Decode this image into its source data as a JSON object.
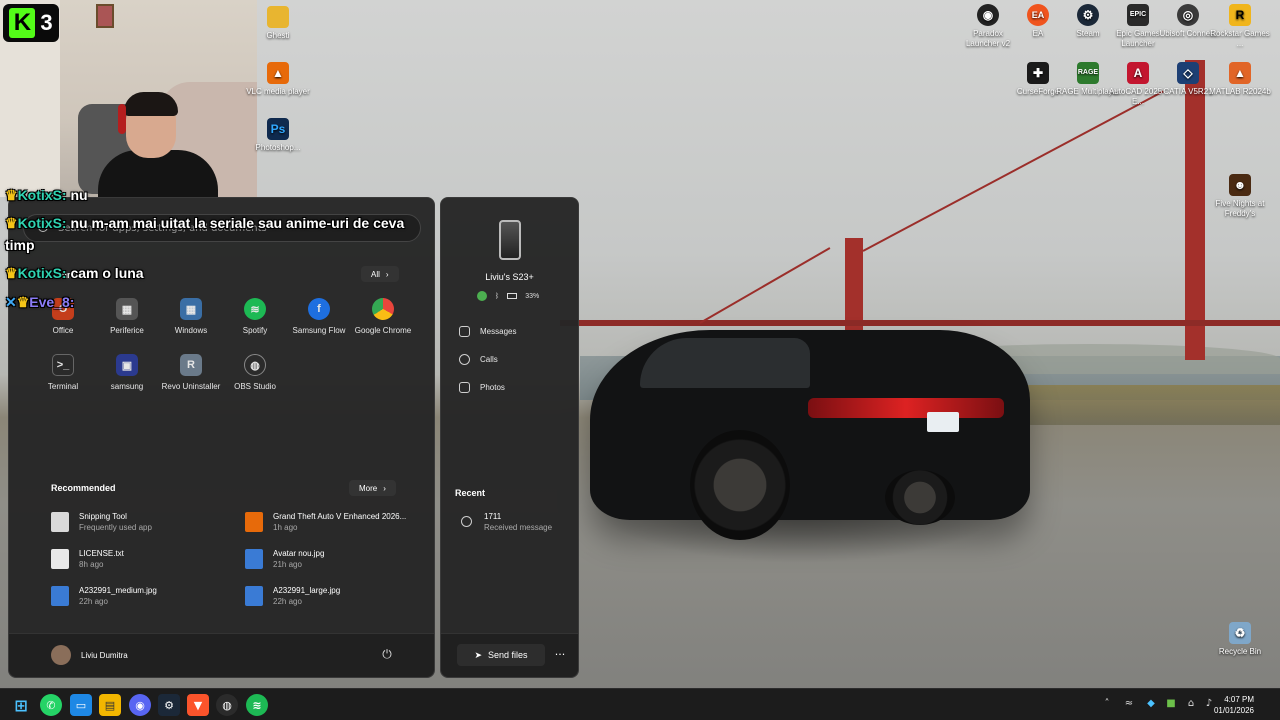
{
  "overlay": {
    "logo_letter": "K",
    "logo_count": "3"
  },
  "chat": [
    {
      "user": "KotixS:",
      "text": "nu"
    },
    {
      "user": "KotixS:",
      "text": "nu m-am mai uitat la seriale sau anime-uri de ceva"
    },
    {
      "user": "",
      "text": "timp"
    },
    {
      "user": "KotixS:",
      "text": "cam o luna"
    },
    {
      "user": "Eve_8:",
      "text": ""
    }
  ],
  "desktop_left": [
    {
      "label": "Ghesti",
      "icon": "folder-icon",
      "color": "#e8b530"
    },
    {
      "label": "VLC media player",
      "icon": "vlc-icon",
      "color": "#e76a0a"
    },
    {
      "label": "Photoshop...",
      "icon": "photoshop-icon",
      "color": "#0f2a4e"
    }
  ],
  "desktop_right": [
    {
      "label": "Paradox Launcher v2",
      "icon": "paradox-icon",
      "color": "#222"
    },
    {
      "label": "EA",
      "icon": "ea-icon",
      "color": "#f0541e"
    },
    {
      "label": "Steam",
      "icon": "steam-icon",
      "color": "#1b2838"
    },
    {
      "label": "Epic Games Launcher",
      "icon": "epic-icon",
      "color": "#2a2a2a"
    },
    {
      "label": "Ubisoft Connect",
      "icon": "ubisoft-icon",
      "color": "#3a3a3a"
    },
    {
      "label": "Rockstar Games ...",
      "icon": "rockstar-icon",
      "color": "#f0b51c"
    },
    {
      "label": "CurseForge",
      "icon": "curseforge-icon",
      "color": "#1a1a1a"
    },
    {
      "label": "RAGE Multiplayer",
      "icon": "rage-icon",
      "color": "#2d7a2d"
    },
    {
      "label": "AutoCAD 2025 - E...",
      "icon": "autocad-icon",
      "color": "#c3162f"
    },
    {
      "label": "CATIA V5R21",
      "icon": "catia-icon",
      "color": "#1d3f74"
    },
    {
      "label": "MATLAB R2024b",
      "icon": "matlab-icon",
      "color": "#e16527"
    },
    {
      "label": "Five Nights at Freddy's",
      "icon": "fnaf-icon",
      "color": "#4a2a12"
    },
    {
      "label": "Recycle Bin",
      "icon": "recycle-bin-icon",
      "color": "#7fa7c9"
    }
  ],
  "start": {
    "search_placeholder": "Search for apps, settings, and documents",
    "pinned_title": "Pinned",
    "all_label": "All",
    "pinned": [
      {
        "label": "Office",
        "icon": "office-icon",
        "color": "#c43e1c"
      },
      {
        "label": "Periferice",
        "icon": "periferice-icon",
        "color": "#555"
      },
      {
        "label": "Windows",
        "icon": "windows-folder-icon",
        "color": "#3a6ea5"
      },
      {
        "label": "Spotify",
        "icon": "spotify-icon",
        "color": "#1db954"
      },
      {
        "label": "Samsung Flow",
        "icon": "samsung-flow-icon",
        "color": "#1e6fe0"
      },
      {
        "label": "Google Chrome",
        "icon": "chrome-icon",
        "color": "#e8453c"
      },
      {
        "label": "Terminal",
        "icon": "terminal-icon",
        "color": "#2a2a2a"
      },
      {
        "label": "samsung",
        "icon": "samsung-icon",
        "color": "#2b3a8f"
      },
      {
        "label": "Revo Uninstaller",
        "icon": "revo-icon",
        "color": "#6a7a8a"
      },
      {
        "label": "OBS Studio",
        "icon": "obs-icon",
        "color": "#2b2b2b"
      }
    ],
    "recommended_title": "Recommended",
    "more_label": "More",
    "recommended": [
      {
        "title": "Snipping Tool",
        "sub": "Frequently used app",
        "icon": "snipping-tool-icon",
        "color": "#d9d9d9"
      },
      {
        "title": "Grand Theft Auto V Enhanced 2026...",
        "sub": "1h ago",
        "icon": "vlc-icon",
        "color": "#e76a0a"
      },
      {
        "title": "LICENSE.txt",
        "sub": "8h ago",
        "icon": "text-file-icon",
        "color": "#e8e8e8"
      },
      {
        "title": "Avatar nou.jpg",
        "sub": "21h ago",
        "icon": "image-file-icon",
        "color": "#3a7bd5"
      },
      {
        "title": "A232991_medium.jpg",
        "sub": "22h ago",
        "icon": "image-file-icon",
        "color": "#3a7bd5"
      },
      {
        "title": "A232991_large.jpg",
        "sub": "22h ago",
        "icon": "image-file-icon",
        "color": "#3a7bd5"
      }
    ],
    "user_name": "Liviu Dumitra"
  },
  "phone": {
    "device_name": "Liviu's S23+",
    "battery": "33%",
    "items": [
      "Messages",
      "Calls",
      "Photos"
    ],
    "recent_title": "Recent",
    "recent": {
      "title": "1711",
      "sub": "Received message"
    },
    "send_label": "Send files"
  },
  "clock": {
    "time": "4:07 PM",
    "date": "01/01/2026"
  }
}
